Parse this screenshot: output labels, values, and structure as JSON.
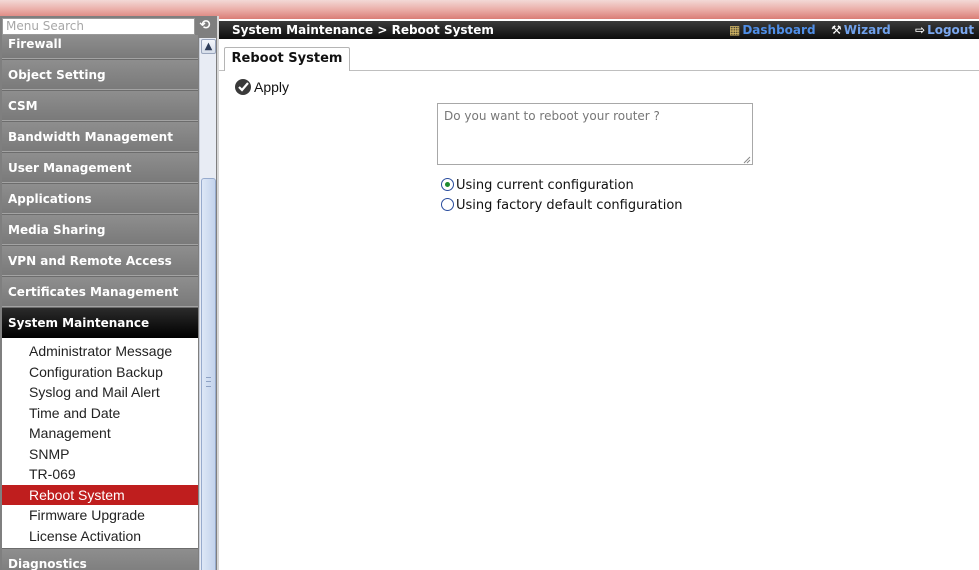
{
  "sidebar": {
    "search_placeholder": "Menu Search",
    "menu": [
      {
        "label": "Firewall"
      },
      {
        "label": "Object Setting"
      },
      {
        "label": "CSM"
      },
      {
        "label": "Bandwidth Management"
      },
      {
        "label": "User Management"
      },
      {
        "label": "Applications"
      },
      {
        "label": "Media Sharing"
      },
      {
        "label": "VPN and Remote Access"
      },
      {
        "label": "Certificates Management"
      },
      {
        "label": "System Maintenance"
      },
      {
        "label": "Diagnostics"
      }
    ],
    "submenu": [
      {
        "label": "Administrator Message"
      },
      {
        "label": "Configuration Backup"
      },
      {
        "label": "Syslog and Mail Alert"
      },
      {
        "label": "Time and Date"
      },
      {
        "label": "Management"
      },
      {
        "label": "SNMP"
      },
      {
        "label": "TR-069"
      },
      {
        "label": "Reboot System"
      },
      {
        "label": "Firmware Upgrade"
      },
      {
        "label": "License Activation"
      }
    ]
  },
  "header": {
    "breadcrumb": "System Maintenance > Reboot System",
    "dashboard_label": "Dashboard",
    "wizard_label": "Wizard",
    "logout_label": "Logout"
  },
  "tabs": [
    {
      "label": "Reboot System"
    }
  ],
  "content": {
    "apply_label": "Apply",
    "message": "Do you want to reboot your router ?",
    "options": [
      {
        "label": "Using current configuration",
        "checked": true
      },
      {
        "label": "Using factory default configuration",
        "checked": false
      }
    ]
  },
  "colors": {
    "selected_item": "#bf1e1e",
    "sidebar": "#7f7f7f",
    "titlebar": "#1a1a1a",
    "link": "#4f8ee6"
  }
}
